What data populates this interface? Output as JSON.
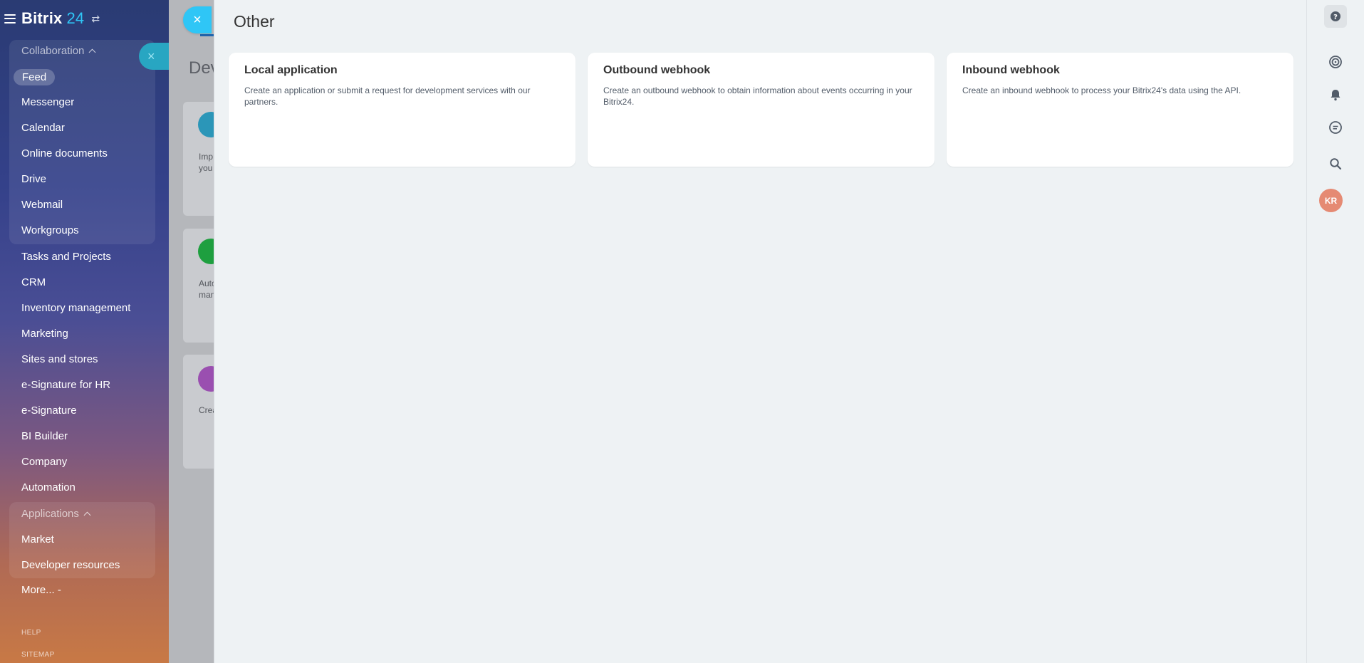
{
  "app": {
    "logo_text": "Bitrix",
    "logo_number": "24"
  },
  "sidebar": {
    "collaboration_title": "Collaboration",
    "collaboration_items": [
      "Feed",
      "Messenger",
      "Calendar",
      "Online documents",
      "Drive",
      "Webmail",
      "Workgroups"
    ],
    "main_items": [
      "Tasks and Projects",
      "CRM",
      "Inventory management",
      "Marketing",
      "Sites and stores",
      "e-Signature for HR",
      "e-Signature",
      "BI Builder",
      "Company",
      "Automation"
    ],
    "applications_title": "Applications",
    "applications_items": [
      "Market",
      "Developer resources"
    ],
    "more_label": "More... -",
    "help_label": "HELP",
    "sitemap_label": "SITEMAP"
  },
  "background_page": {
    "title_fragment": "Dev",
    "snippet_1": "Imp\nyou",
    "snippet_2": "Auto\nman",
    "snippet_3": "Crea"
  },
  "slider": {
    "title": "Other",
    "cards": [
      {
        "title": "Local application",
        "description": "Create an application or submit a request for development services with our partners."
      },
      {
        "title": "Outbound webhook",
        "description": "Create an outbound webhook to obtain information about events occurring in your Bitrix24."
      },
      {
        "title": "Inbound webhook",
        "description": "Create an inbound webhook to process your Bitrix24's data using the API."
      }
    ]
  },
  "rightbar": {
    "avatar_initials": "KR"
  },
  "colors": {
    "accent": "#2fc6f6",
    "avatar": "#e58a73",
    "panel_bg": "#eef2f4"
  }
}
